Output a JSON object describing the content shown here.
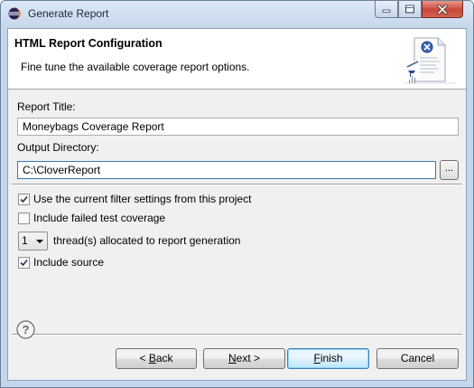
{
  "window": {
    "title": "Generate Report",
    "icon": "eclipse-icon"
  },
  "header": {
    "title": "HTML Report Configuration",
    "description": "Fine tune the available coverage report options.",
    "graphic": "report-wizard-graphic"
  },
  "form": {
    "report_title_label": "Report Title:",
    "report_title_value": "Moneybags Coverage Report",
    "output_dir_label": "Output Directory:",
    "output_dir_value": "C:\\CloverReport",
    "browse_label": "...",
    "use_filter_label": "Use the current filter settings from this project",
    "use_filter_checked": true,
    "include_failed_label": "Include failed test coverage",
    "include_failed_checked": false,
    "threads_value": "1",
    "threads_label": "thread(s) allocated to report generation",
    "include_source_label": "Include source",
    "include_source_checked": true
  },
  "buttons": {
    "back_mnemonic": "B",
    "back_prefix": "< ",
    "back_rest": "ack",
    "next_mnemonic": "N",
    "next_rest": "ext >",
    "finish_mnemonic": "F",
    "finish_rest": "inish",
    "cancel": "Cancel"
  },
  "colors": {
    "titlebar": "#c6d7ec",
    "client_bg": "#f0f0f0",
    "default_button_border": "#3c7fb1",
    "close_button": "#c8473a"
  }
}
